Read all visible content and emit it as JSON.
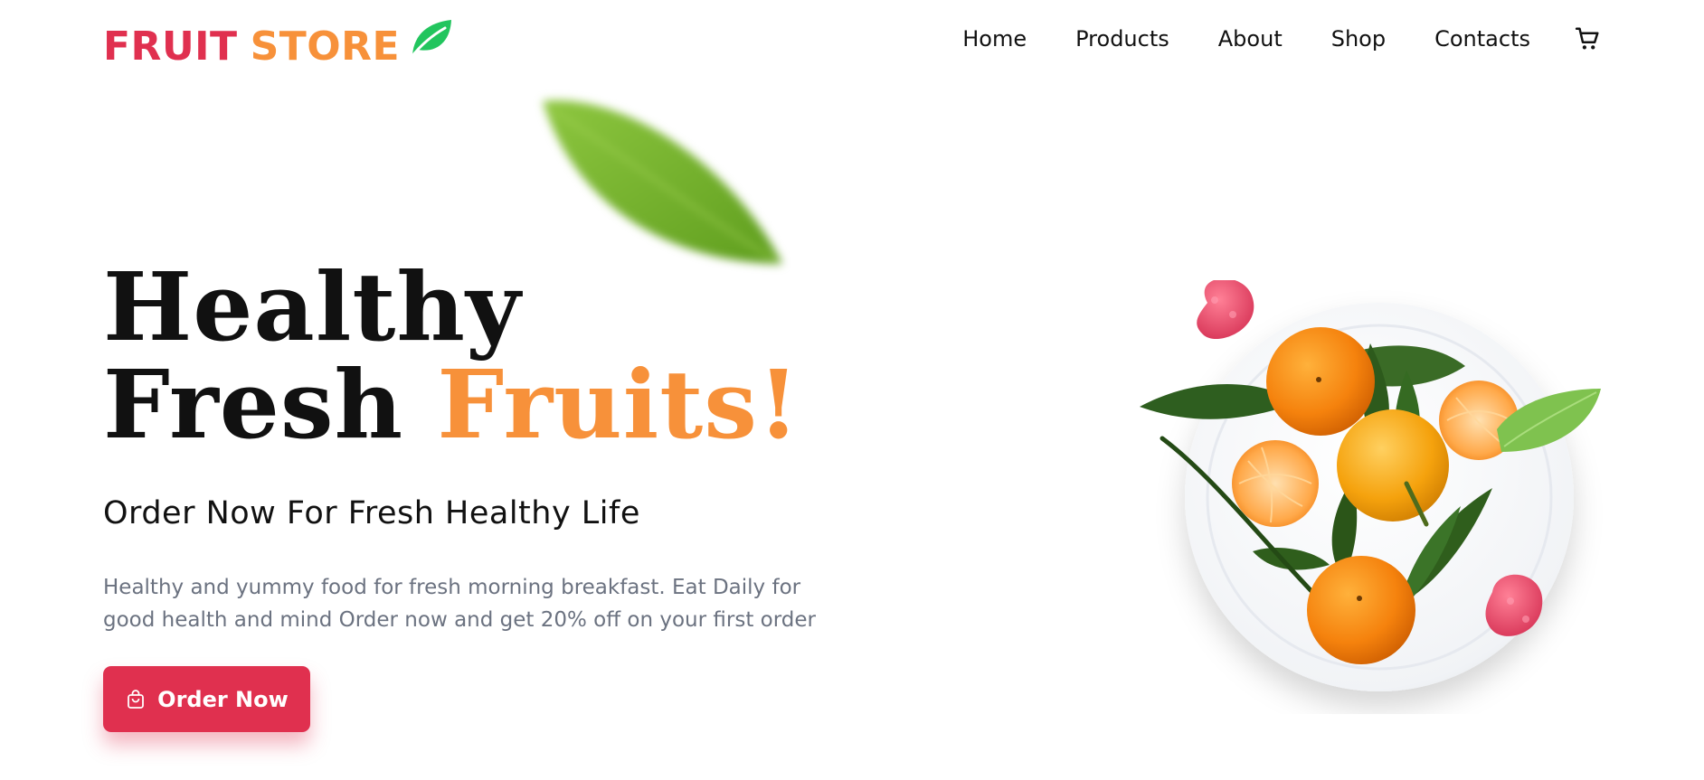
{
  "brand": {
    "word1": "FRUIT",
    "word2": "STORE",
    "color1": "#e0304f",
    "color2": "#f7913a",
    "icon": "leaf-icon"
  },
  "nav": {
    "items": [
      "Home",
      "Products",
      "About",
      "Shop",
      "Contacts"
    ],
    "cart_icon": "cart-icon"
  },
  "hero": {
    "line1": "Healthy",
    "line2_plain": "Fresh",
    "line2_accent": "Fruits!",
    "subtitle": "Order Now For Fresh Healthy Life",
    "description": "Healthy and yummy food for fresh morning breakfast. Eat Daily for good health and mind Order now and get 20% off on your first order",
    "button_label": "Order Now",
    "button_icon": "shopping-bag-icon",
    "accent_color": "#f7913a",
    "button_color": "#e0304f"
  },
  "illustration": {
    "plate": "fruit-plate-image",
    "decor_leaf": "blurred-leaf-image"
  }
}
